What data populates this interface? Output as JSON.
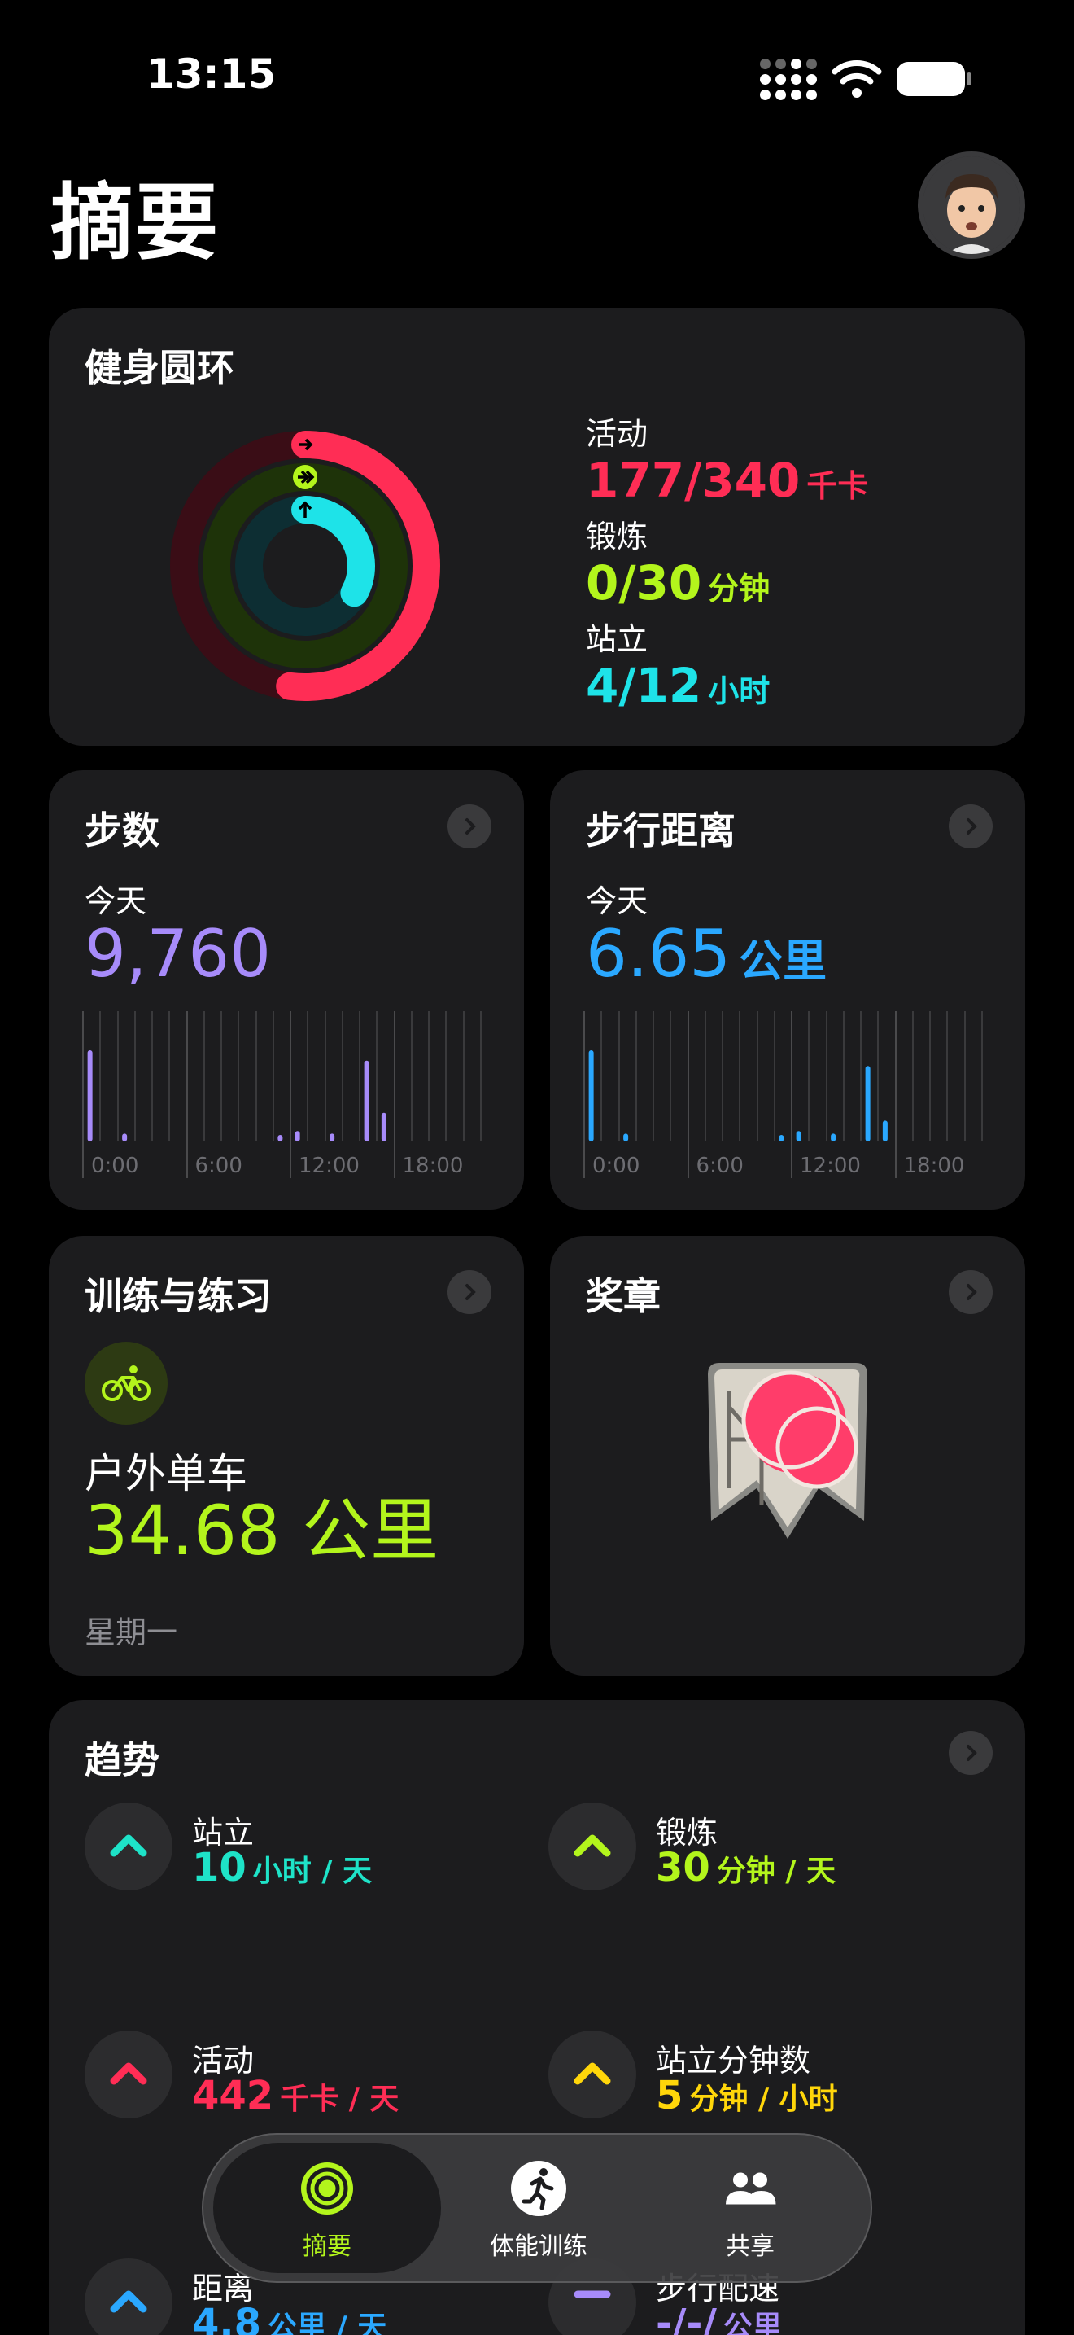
{
  "status_bar": {
    "time": "13:15"
  },
  "header": {
    "title": "摘要"
  },
  "rings_card": {
    "title": "健身圆环",
    "move": {
      "label": "活动",
      "value": "177/340",
      "unit": "千卡",
      "color": "#ff2d55",
      "progress": 0.52
    },
    "exercise": {
      "label": "锻炼",
      "value": "0/30",
      "unit": "分钟",
      "color": "#b3f51c",
      "progress": 0.0
    },
    "stand": {
      "label": "站立",
      "value": "4/12",
      "unit": "小时",
      "color": "#1ee3e8",
      "progress": 0.33
    }
  },
  "steps_card": {
    "title": "步数",
    "period": "今天",
    "value": "9,760",
    "unit": "",
    "color": "#a78bfa",
    "ticks": [
      "0:00",
      "6:00",
      "12:00",
      "18:00"
    ],
    "bars": [
      0.7,
      0,
      0.06,
      0,
      0,
      0,
      0,
      0,
      0,
      0,
      0,
      0.05,
      0.08,
      0,
      0.06,
      0,
      0.62,
      0.22,
      0,
      0,
      0,
      0,
      0,
      0
    ]
  },
  "distance_card": {
    "title": "步行距离",
    "period": "今天",
    "value": "6.65",
    "unit": "公里",
    "color": "#2aa8ff",
    "ticks": [
      "0:00",
      "6:00",
      "12:00",
      "18:00"
    ],
    "bars": [
      0.7,
      0,
      0.06,
      0,
      0,
      0,
      0,
      0,
      0,
      0,
      0,
      0.05,
      0.08,
      0,
      0.06,
      0,
      0.58,
      0.16,
      0,
      0,
      0,
      0,
      0,
      0
    ]
  },
  "workouts_card": {
    "title": "训练与练习",
    "workout_name": "户外单车",
    "value": "34.68 公里",
    "day": "星期一",
    "icon": "bicycle-icon"
  },
  "awards_card": {
    "title": "奖章",
    "icon": "award-medal"
  },
  "trends_card": {
    "title": "趋势",
    "items": [
      {
        "label": "站立",
        "value": "10",
        "unit": "小时 / 天",
        "color": "#1ee3c8"
      },
      {
        "label": "锻炼",
        "value": "30",
        "unit": "分钟 / 天",
        "color": "#b3f51c"
      },
      {
        "label": "活动",
        "value": "442",
        "unit": "千卡 / 天",
        "color": "#ff2d55"
      },
      {
        "label": "站立分钟数",
        "value": "5",
        "unit": "分钟 / 小时",
        "color": "#ffd60a"
      },
      {
        "label": "距离",
        "value": "4.8",
        "unit": "公里 / 天",
        "color": "#2aa8ff"
      },
      {
        "label": "步行配速",
        "value": "-/-/",
        "unit": "公里",
        "color": "#a78bfa"
      }
    ]
  },
  "tab_bar": {
    "tabs": [
      {
        "label": "摘要",
        "icon": "rings-icon",
        "active": true
      },
      {
        "label": "体能训练",
        "icon": "runner-icon",
        "active": false
      },
      {
        "label": "共享",
        "icon": "people-icon",
        "active": false
      }
    ]
  }
}
